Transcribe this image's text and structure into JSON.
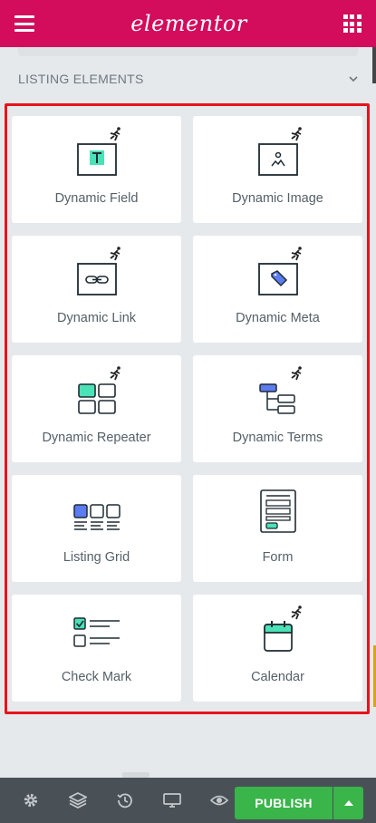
{
  "header": {
    "logo_text": "elementor",
    "menu_icon": "hamburger-icon",
    "apps_icon": "grid-icon",
    "bg_color": "#d30c5c"
  },
  "section": {
    "title": "LISTING ELEMENTS",
    "toggle_icon": "chevron-down-icon"
  },
  "widgets": [
    {
      "label": "Dynamic Field",
      "icon": "dynamic-field-icon",
      "pro": true
    },
    {
      "label": "Dynamic Image",
      "icon": "dynamic-image-icon",
      "pro": true
    },
    {
      "label": "Dynamic Link",
      "icon": "dynamic-link-icon",
      "pro": true
    },
    {
      "label": "Dynamic Meta",
      "icon": "dynamic-meta-icon",
      "pro": true
    },
    {
      "label": "Dynamic Repeater",
      "icon": "dynamic-repeater-icon",
      "pro": true
    },
    {
      "label": "Dynamic Terms",
      "icon": "dynamic-terms-icon",
      "pro": true
    },
    {
      "label": "Listing Grid",
      "icon": "listing-grid-icon",
      "pro": false
    },
    {
      "label": "Form",
      "icon": "form-icon",
      "pro": false
    },
    {
      "label": "Check Mark",
      "icon": "check-mark-icon",
      "pro": false
    },
    {
      "label": "Calendar",
      "icon": "calendar-icon",
      "pro": true
    }
  ],
  "footer": {
    "publish_label": "PUBLISH",
    "buttons": [
      "settings-icon",
      "layers-icon",
      "history-icon",
      "responsive-icon",
      "preview-icon"
    ],
    "publish_color": "#39b54a"
  },
  "colors": {
    "accent": "#d30c5c",
    "highlight_border": "#e8131a",
    "icon_teal": "#4ae2b6",
    "icon_blue": "#5b7cf2"
  }
}
